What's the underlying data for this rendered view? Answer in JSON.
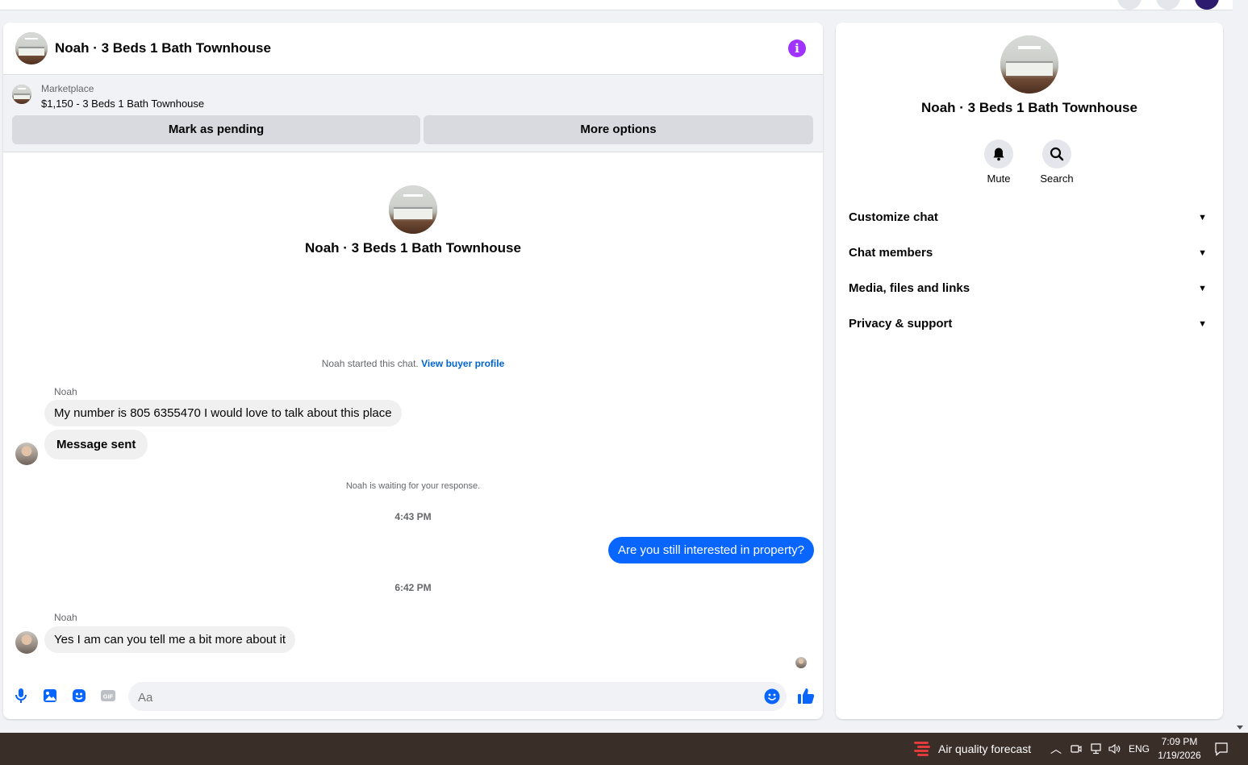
{
  "chat": {
    "title": "Noah · 3 Beds 1 Bath Townhouse",
    "listing": {
      "label": "Marketplace",
      "title": "$1,150 - 3 Beds 1 Bath Townhouse"
    },
    "buttons": {
      "mark_pending": "Mark as pending",
      "more_options": "More options"
    },
    "intro_name": "Noah · 3 Beds 1 Bath Townhouse",
    "started_text": "Noah started this chat.",
    "view_profile_link": "View buyer profile",
    "messages": [
      {
        "sender": "Noah",
        "text": "My number is 805 6355470 I would love to talk about this place"
      },
      {
        "text": "Message sent"
      }
    ],
    "waiting_text": "Noah is waiting for your response.",
    "time_1": "4:43 PM",
    "sent_message": "Are you still interested in property?",
    "time_2": "6:42 PM",
    "reply": {
      "sender": "Noah",
      "text": "Yes I am can you tell me a bit more about it"
    },
    "composer": {
      "placeholder": "Aa"
    }
  },
  "side": {
    "name": "Noah · 3 Beds 1 Bath Townhouse",
    "actions": {
      "mute": "Mute",
      "search": "Search"
    },
    "sections": [
      "Customize chat",
      "Chat members",
      "Media, files and links",
      "Privacy & support"
    ]
  },
  "taskbar": {
    "weather": "Air quality forecast",
    "language": "ENG",
    "time": "7:09 PM",
    "date": "1/19/2026"
  },
  "colors": {
    "accent": "#0866ff",
    "info": "#a033ff"
  }
}
